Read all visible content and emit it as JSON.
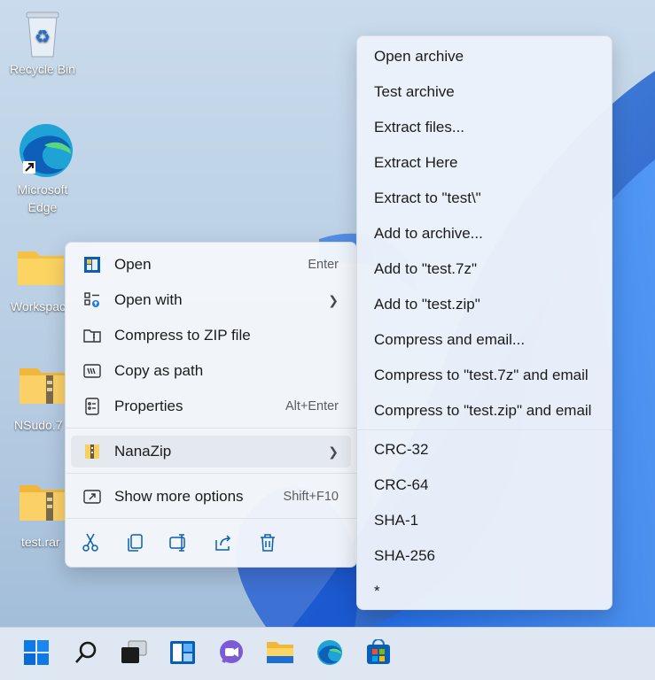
{
  "desktop": {
    "icons": [
      {
        "label": "Recycle Bin"
      },
      {
        "label": "Microsoft Edge"
      },
      {
        "label": "Workspac"
      },
      {
        "label": "NSudo.7"
      },
      {
        "label": "test.rar"
      }
    ]
  },
  "context_menu": {
    "items": [
      {
        "label": "Open",
        "shortcut": "Enter",
        "icon": "open-app-icon"
      },
      {
        "label": "Open with",
        "shortcut": "",
        "icon": "open-with-icon",
        "has_submenu": true
      },
      {
        "label": "Compress to ZIP file",
        "shortcut": "",
        "icon": "zip-folder-icon"
      },
      {
        "label": "Copy as path",
        "shortcut": "",
        "icon": "copy-path-icon"
      },
      {
        "label": "Properties",
        "shortcut": "Alt+Enter",
        "icon": "properties-icon"
      },
      {
        "label": "NanaZip",
        "shortcut": "",
        "icon": "nanazip-icon",
        "has_submenu": true,
        "highlighted": true
      },
      {
        "label": "Show more options",
        "shortcut": "Shift+F10",
        "icon": "show-more-icon"
      }
    ],
    "quick_actions": [
      "cut-icon",
      "copy-icon",
      "rename-icon",
      "share-icon",
      "delete-icon"
    ],
    "accent_color": "#0a5fb4"
  },
  "submenu": {
    "items": [
      {
        "label": "Open archive"
      },
      {
        "label": "Test archive"
      },
      {
        "label": "Extract files..."
      },
      {
        "label": "Extract Here"
      },
      {
        "label": "Extract to \"test\\\""
      },
      {
        "label": "Add to archive..."
      },
      {
        "label": "Add to \"test.7z\""
      },
      {
        "label": "Add to \"test.zip\""
      },
      {
        "label": "Compress and email..."
      },
      {
        "label": "Compress to \"test.7z\" and email"
      },
      {
        "label": "Compress to \"test.zip\" and email"
      },
      {
        "label": "CRC-32"
      },
      {
        "label": "CRC-64"
      },
      {
        "label": "SHA-1"
      },
      {
        "label": "SHA-256"
      },
      {
        "label": "*"
      }
    ]
  },
  "taskbar": {
    "items": [
      "start-icon",
      "search-icon",
      "task-view-icon",
      "widgets-icon",
      "chat-icon",
      "file-explorer-icon",
      "edge-icon",
      "store-icon"
    ]
  }
}
